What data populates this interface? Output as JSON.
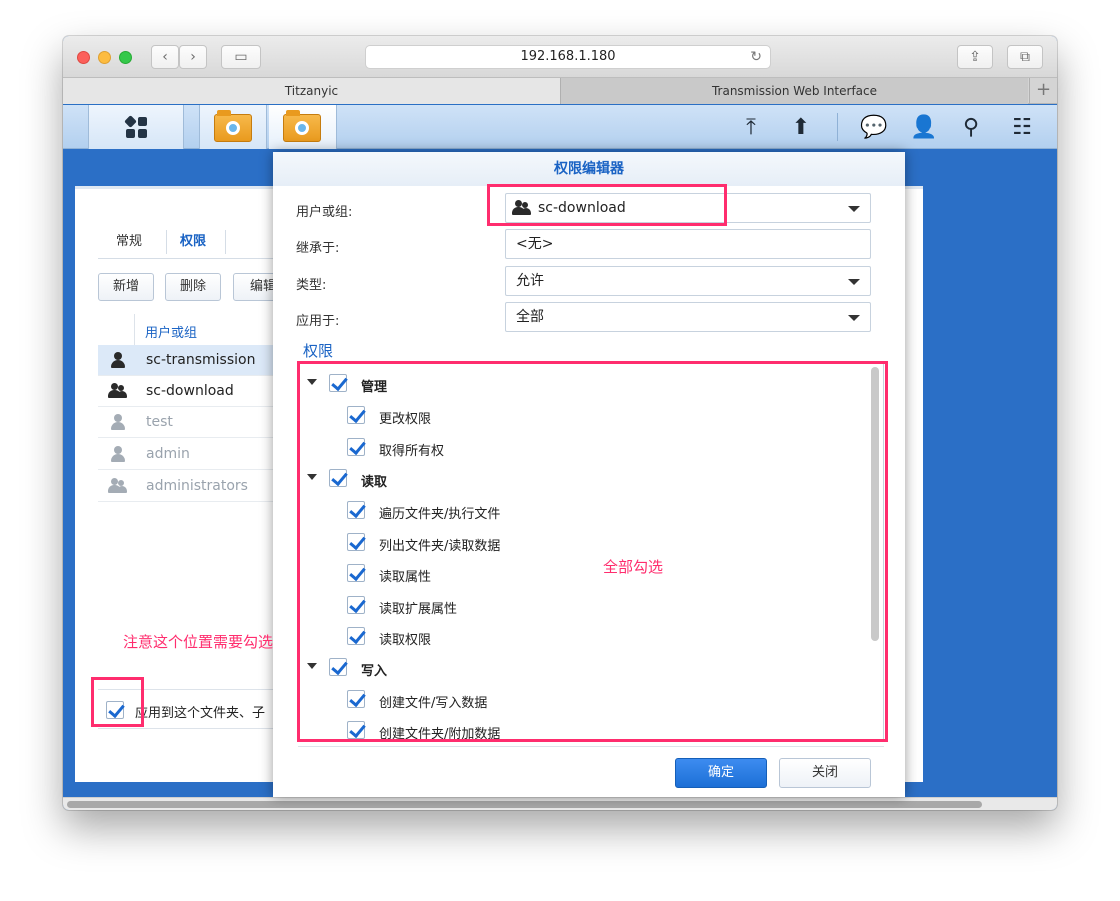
{
  "browser": {
    "url": "192.168.1.180",
    "tabs": [
      "Titzanyic",
      "Transmission Web Interface"
    ],
    "new_tab": "+"
  },
  "back_window": {
    "tabs": [
      "常规",
      "权限"
    ],
    "buttons": [
      "新增",
      "删除",
      "编辑"
    ],
    "column_header": "用户或组",
    "users": [
      {
        "name": "sc-transmission",
        "type": "user",
        "selected": true,
        "dim": false
      },
      {
        "name": "sc-download",
        "type": "group",
        "selected": false,
        "dim": false
      },
      {
        "name": "test",
        "type": "user",
        "selected": false,
        "dim": true
      },
      {
        "name": "admin",
        "type": "user",
        "selected": false,
        "dim": true
      },
      {
        "name": "administrators",
        "type": "group",
        "selected": false,
        "dim": true
      }
    ],
    "apply_label": "应用到这个文件夹、子"
  },
  "dialog": {
    "title": "权限编辑器",
    "user_label": "用户或组:",
    "user_value": "sc-download",
    "inherit_label": "继承于:",
    "inherit_value": "<无>",
    "type_label": "类型:",
    "type_value": "允许",
    "apply_label": "应用于:",
    "apply_value": "全部",
    "perm_header": "权限",
    "tree": [
      {
        "label": "管理",
        "level": 0,
        "checked": true
      },
      {
        "label": "更改权限",
        "level": 1,
        "checked": true
      },
      {
        "label": "取得所有权",
        "level": 1,
        "checked": true
      },
      {
        "label": "读取",
        "level": 0,
        "checked": true
      },
      {
        "label": "遍历文件夹/执行文件",
        "level": 1,
        "checked": true
      },
      {
        "label": "列出文件夹/读取数据",
        "level": 1,
        "checked": true
      },
      {
        "label": "读取属性",
        "level": 1,
        "checked": true
      },
      {
        "label": "读取扩展属性",
        "level": 1,
        "checked": true
      },
      {
        "label": "读取权限",
        "level": 1,
        "checked": true
      },
      {
        "label": "写入",
        "level": 0,
        "checked": true
      },
      {
        "label": "创建文件/写入数据",
        "level": 1,
        "checked": true
      },
      {
        "label": "创建文件夹/附加数据",
        "level": 1,
        "checked": true
      }
    ],
    "ok_label": "确定",
    "close_label": "关闭"
  },
  "annotations": {
    "check_all": "全部勾选",
    "note": "注意这个位置需要勾选"
  },
  "colors": {
    "accent": "#1a63c4",
    "annotation": "#ff2d6e",
    "desktop": "#2b6fc6"
  }
}
